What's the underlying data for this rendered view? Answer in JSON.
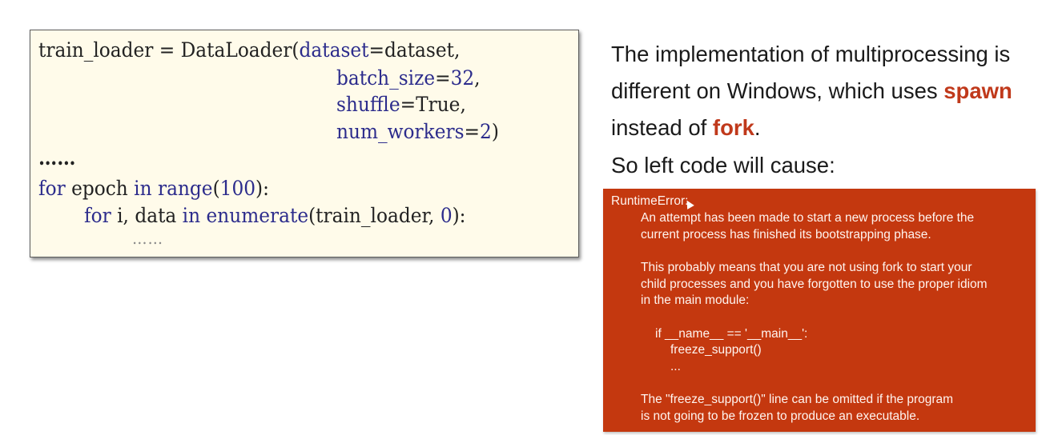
{
  "code": {
    "line1": {
      "a": "train_loader = DataLoader(",
      "b": "dataset",
      "c": "=dataset,"
    },
    "line2": {
      "a": "batch_size",
      "b": "=",
      "c": "32",
      "d": ","
    },
    "line3": {
      "a": "shuffle",
      "b": "=True,"
    },
    "line4": {
      "a": "num_workers",
      "b": "=",
      "c": "2",
      "d": ")"
    },
    "ellipsis1": "……",
    "line5": {
      "kw1": "for",
      "a": " epoch ",
      "kw2": "in",
      "b": " ",
      "kw3": "range",
      "c": "(",
      "num": "100",
      "d": "):"
    },
    "line6": {
      "kw1": "for",
      "a": " i, data ",
      "kw2": "in",
      "b": " ",
      "kw3": "enumerate",
      "c": "(train_loader, ",
      "num": "0",
      "d": "):"
    },
    "ellipsis2": "……"
  },
  "description": {
    "line1": "The implementation of multiprocessing is",
    "line2_a": "different on Windows, which uses ",
    "line2_hl": "spawn",
    "line3_a": "instead of ",
    "line3_hl": "fork",
    "line3_b": ".",
    "line4": "So left code will cause:"
  },
  "error": {
    "title": "RuntimeError:",
    "lines": [
      "An attempt has been made to start a new process before the",
      "current process has finished its bootstrapping phase.",
      "This probably means that you are not using fork to start your",
      "child processes and you have forgotten to use the proper idiom",
      "in the main module:",
      "if __name__ == '__main__':",
      "freeze_support()",
      "...",
      "The \"freeze_support()\" line can be omitted if the program",
      "is not going to be frozen to produce an executable."
    ]
  },
  "colors": {
    "highlight": "#c0391b",
    "error_background": "#c4380f",
    "code_background": "#fffbea",
    "keyword": "#2c2c8c"
  }
}
